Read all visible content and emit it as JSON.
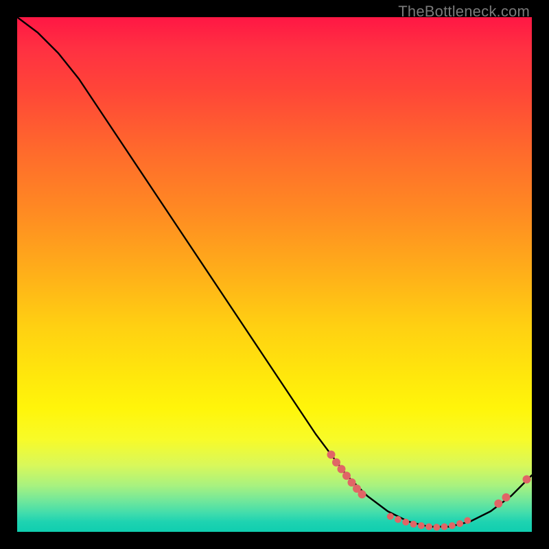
{
  "watermark": "TheBottleneck.com",
  "chart_data": {
    "type": "line",
    "title": "",
    "xlabel": "",
    "ylabel": "",
    "xlim": [
      0,
      100
    ],
    "ylim": [
      0,
      100
    ],
    "grid": false,
    "legend": false,
    "series": [
      {
        "name": "curve",
        "x": [
          0,
          4,
          8,
          12,
          18,
          26,
          34,
          42,
          50,
          58,
          64,
          68,
          72,
          76,
          80,
          84,
          88,
          92,
          96,
          100
        ],
        "y": [
          100,
          97,
          93,
          88,
          79,
          67,
          55,
          43,
          31,
          19,
          11,
          7,
          4,
          2,
          1,
          1,
          2,
          4,
          7,
          11
        ]
      }
    ],
    "markers": [
      {
        "x": 61.0,
        "y": 15.0,
        "r": 6
      },
      {
        "x": 62.0,
        "y": 13.5,
        "r": 6
      },
      {
        "x": 63.0,
        "y": 12.2,
        "r": 6
      },
      {
        "x": 64.0,
        "y": 10.9,
        "r": 6
      },
      {
        "x": 65.0,
        "y": 9.6,
        "r": 6
      },
      {
        "x": 66.0,
        "y": 8.4,
        "r": 6
      },
      {
        "x": 67.0,
        "y": 7.3,
        "r": 6
      },
      {
        "x": 72.5,
        "y": 3.0,
        "r": 5
      },
      {
        "x": 74.0,
        "y": 2.4,
        "r": 5
      },
      {
        "x": 75.5,
        "y": 1.9,
        "r": 5
      },
      {
        "x": 77.0,
        "y": 1.5,
        "r": 5
      },
      {
        "x": 78.5,
        "y": 1.2,
        "r": 5
      },
      {
        "x": 80.0,
        "y": 1.0,
        "r": 5
      },
      {
        "x": 81.5,
        "y": 0.9,
        "r": 5
      },
      {
        "x": 83.0,
        "y": 1.0,
        "r": 5
      },
      {
        "x": 84.5,
        "y": 1.2,
        "r": 5
      },
      {
        "x": 86.0,
        "y": 1.6,
        "r": 5
      },
      {
        "x": 87.5,
        "y": 2.2,
        "r": 5
      },
      {
        "x": 93.5,
        "y": 5.5,
        "r": 6
      },
      {
        "x": 95.0,
        "y": 6.7,
        "r": 6
      },
      {
        "x": 99.0,
        "y": 10.2,
        "r": 6
      }
    ],
    "marker_color": "#e06666",
    "line_color": "#000000"
  }
}
